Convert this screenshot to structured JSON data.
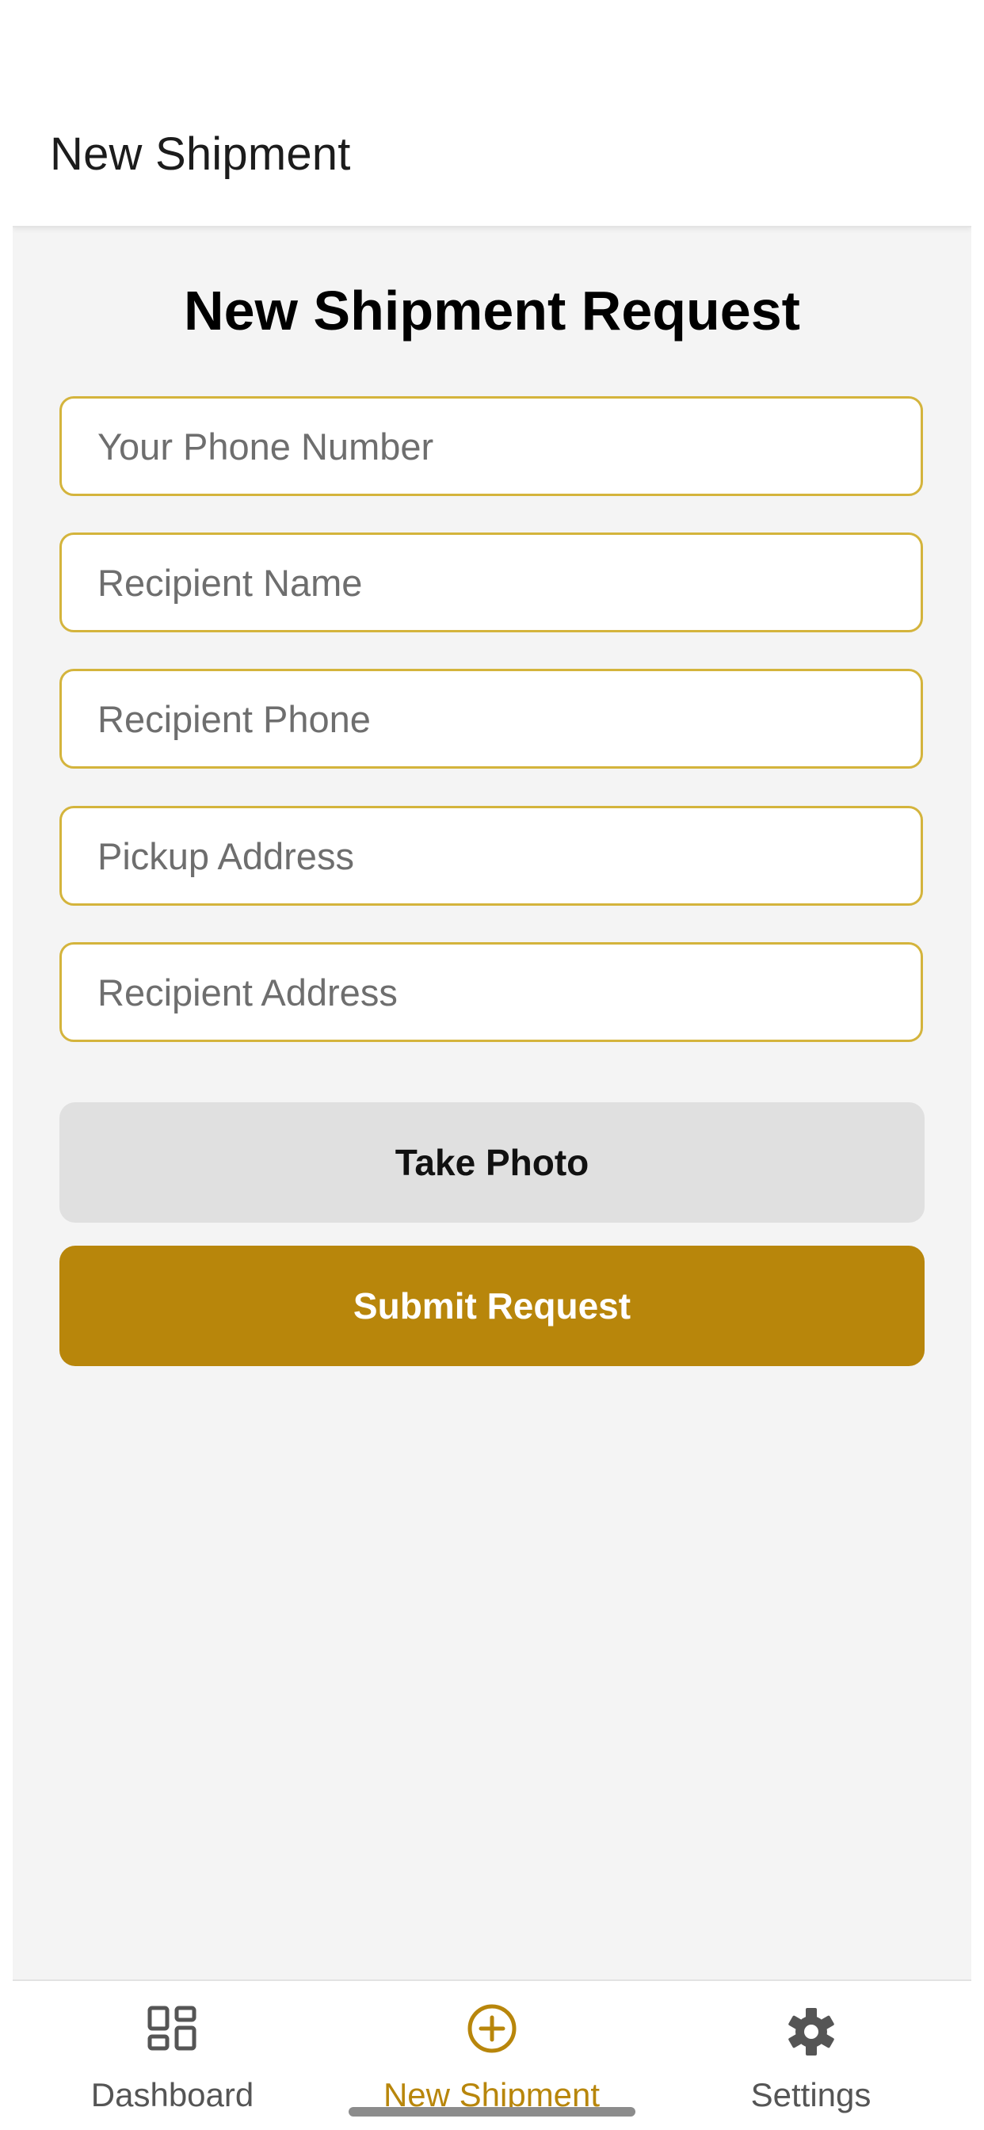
{
  "header": {
    "title": "New Shipment"
  },
  "form": {
    "title": "New Shipment Request",
    "fields": [
      {
        "placeholder": "Your Phone Number",
        "value": ""
      },
      {
        "placeholder": "Recipient Name",
        "value": ""
      },
      {
        "placeholder": "Recipient Phone",
        "value": ""
      },
      {
        "placeholder": "Pickup Address",
        "value": ""
      },
      {
        "placeholder": "Recipient Address",
        "value": ""
      }
    ],
    "take_photo_label": "Take Photo",
    "submit_label": "Submit Request"
  },
  "tabbar": {
    "tabs": [
      {
        "label": "Dashboard",
        "icon": "dashboard-icon",
        "active": false
      },
      {
        "label": "New Shipment",
        "icon": "add-circle-icon",
        "active": true
      },
      {
        "label": "Settings",
        "icon": "gear-icon",
        "active": false
      }
    ]
  },
  "colors": {
    "accent": "#b8860b",
    "field_border": "#d4b43c",
    "background": "#f4f4f4",
    "secondary_button": "#e0e0e0",
    "inactive_tab": "#555555"
  }
}
